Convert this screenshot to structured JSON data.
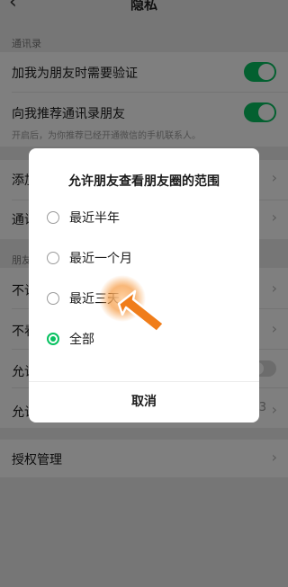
{
  "header": {
    "back_icon": "chevron-left-icon",
    "title": "隐私"
  },
  "contacts_section": {
    "label": "通讯录",
    "verify_label": "加我为朋友时需要验证",
    "verify_on": true,
    "recommend_label": "向我推荐通讯录朋友",
    "recommend_on": true,
    "recommend_hint": "开启后，为你推荐已经开通微信的手机联系人。",
    "add_methods_label_partial": "添加",
    "blacklist_label_partial": "通讯"
  },
  "moments_section": {
    "label_partial": "朋友",
    "hide_mine_partial": "不让",
    "hide_theirs_partial": "不看",
    "allow_stranger_partial": "允许",
    "allow_stranger_on": false,
    "allow_view_partial": "允许",
    "allow_view_suffix": "3"
  },
  "auth_row": {
    "label": "授权管理"
  },
  "dialog": {
    "title": "允许朋友查看朋友圈的范围",
    "options": [
      {
        "label": "最近半年",
        "checked": false
      },
      {
        "label": "最近一个月",
        "checked": false
      },
      {
        "label": "最近三天",
        "checked": false
      },
      {
        "label": "全部",
        "checked": true
      }
    ],
    "cancel_label": "取消"
  },
  "colors": {
    "accent": "#07c160",
    "tap_highlight": "#f6a04d",
    "arrow": "#f07d1a"
  }
}
